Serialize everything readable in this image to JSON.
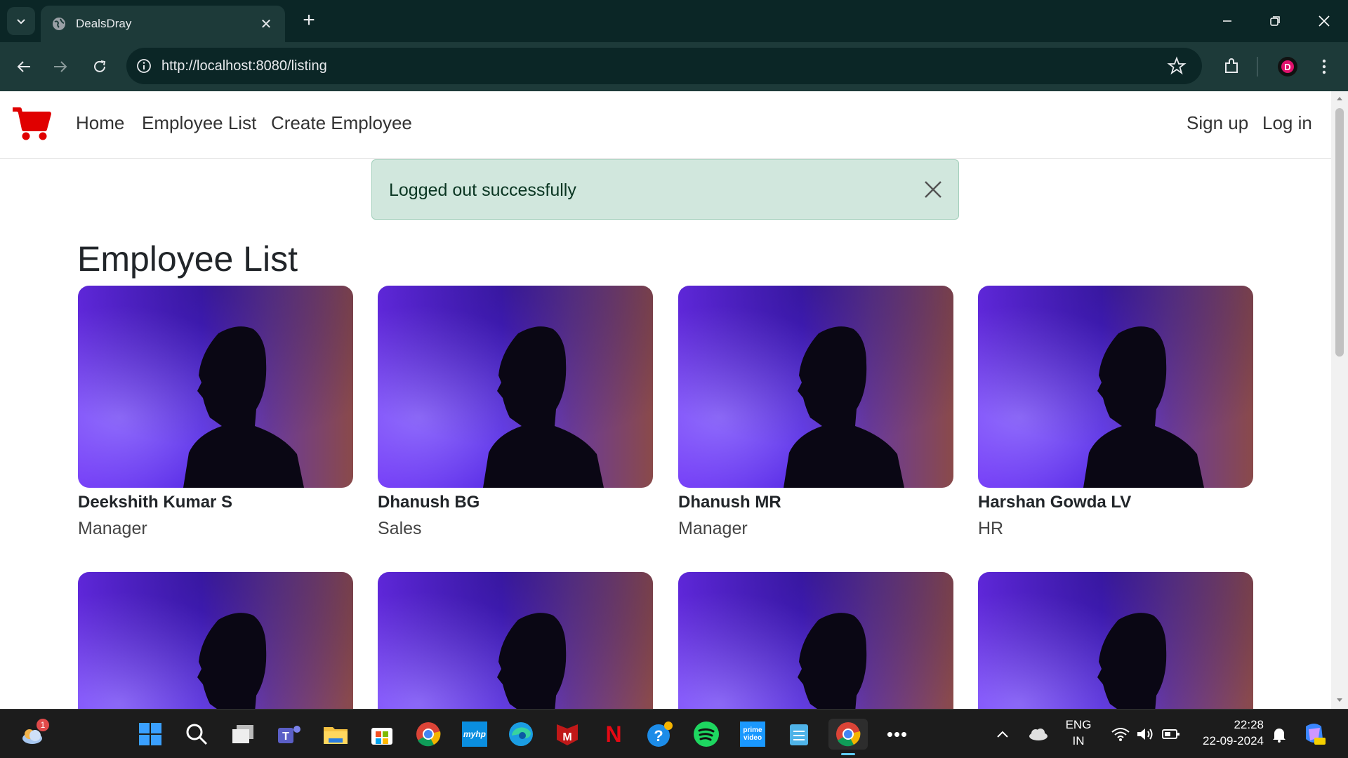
{
  "browser": {
    "tab_title": "DealsDray",
    "url": "http://localhost:8080/listing",
    "avatar_letter": "D"
  },
  "navbar": {
    "links": [
      "Home",
      "Employee List",
      "Create Employee"
    ],
    "right_links": [
      "Sign up",
      "Log in"
    ]
  },
  "alert": {
    "message": "Logged out successfully",
    "color": "#d1e7dd"
  },
  "page": {
    "title": "Employee List",
    "employees": [
      {
        "name": "Deekshith Kumar S",
        "role": "Manager"
      },
      {
        "name": "Dhanush BG",
        "role": "Sales"
      },
      {
        "name": "Dhanush MR",
        "role": "Manager"
      },
      {
        "name": "Harshan Gowda LV",
        "role": "HR"
      },
      {
        "name": "",
        "role": ""
      },
      {
        "name": "",
        "role": ""
      },
      {
        "name": "",
        "role": ""
      },
      {
        "name": "",
        "role": ""
      }
    ]
  },
  "taskbar": {
    "weather_badge": "1",
    "language": "ENG",
    "region": "IN",
    "time": "22:28",
    "date": "22-09-2024",
    "mcafee_label": "M",
    "netflix_label": "N",
    "myhp_label": "myhp",
    "prime_label": "prime video"
  },
  "colors": {
    "brand_red": "#e00000",
    "chrome_dark": "#0b2626",
    "chrome_mid": "#1d3a39"
  }
}
